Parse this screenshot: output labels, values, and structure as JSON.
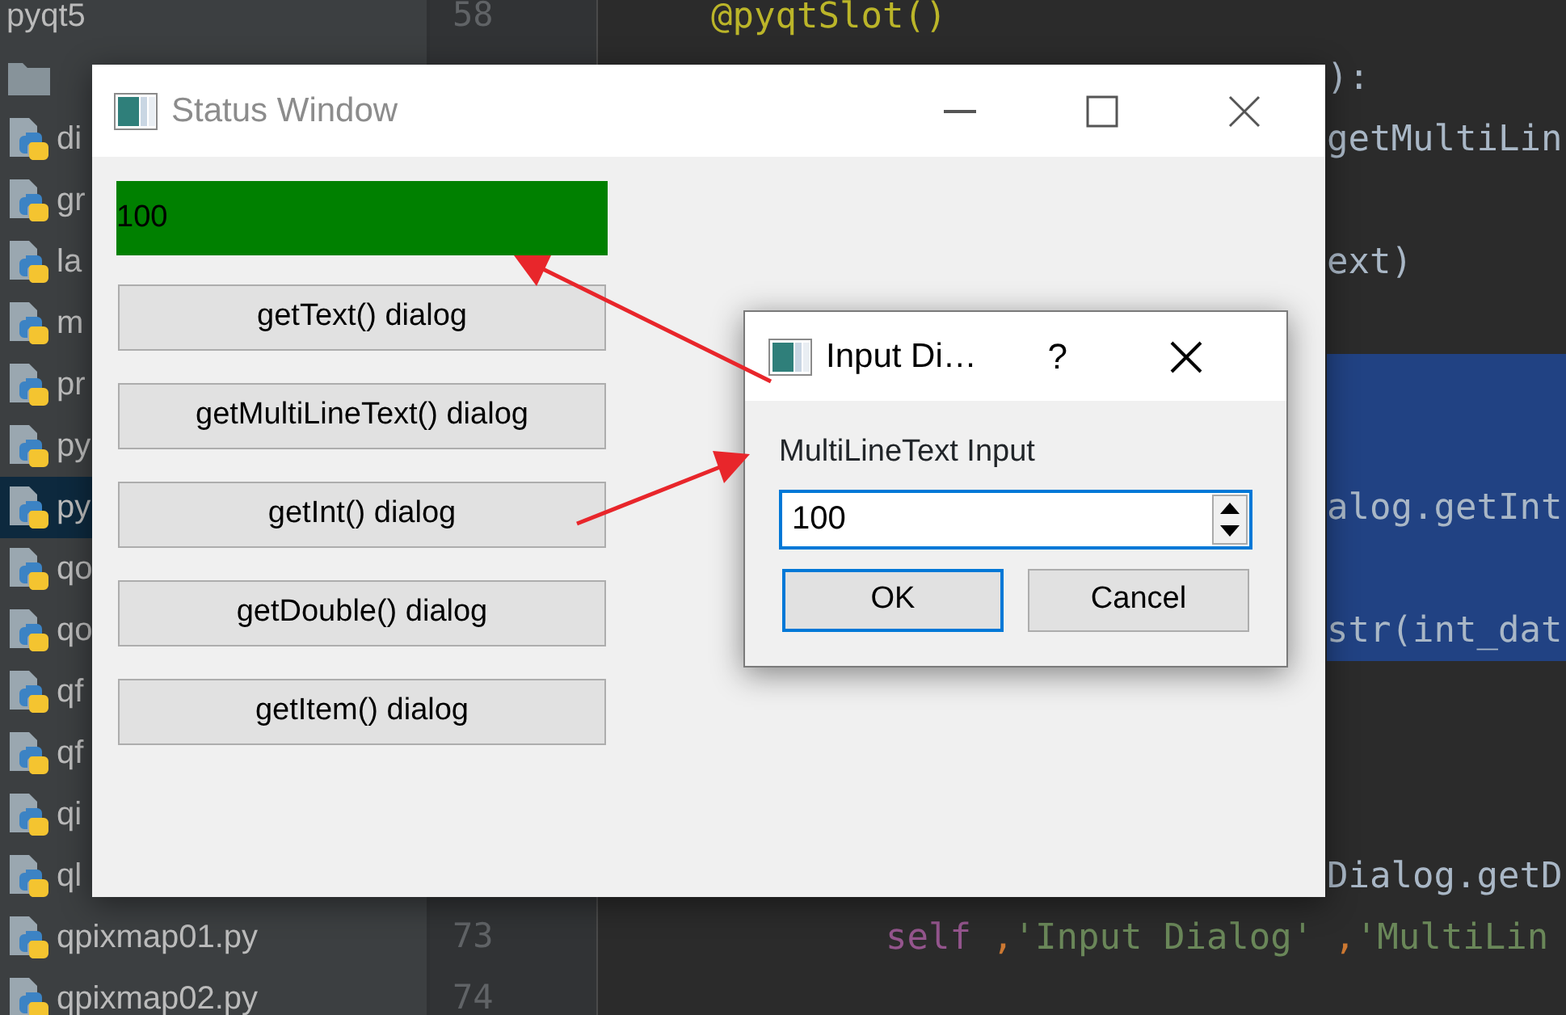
{
  "tree": [
    {
      "label": "pyqt5",
      "kind": "root",
      "selected": false
    },
    {
      "kind": "folder",
      "selected": false
    },
    {
      "label": "di",
      "kind": "python",
      "selected": false
    },
    {
      "label": "gr",
      "kind": "python",
      "selected": false
    },
    {
      "label": "la",
      "kind": "python",
      "selected": false
    },
    {
      "label": "m",
      "kind": "python",
      "selected": false
    },
    {
      "label": "pr",
      "kind": "python",
      "selected": false
    },
    {
      "label": "py",
      "kind": "python",
      "selected": false
    },
    {
      "label": "py",
      "kind": "python",
      "selected": true
    },
    {
      "label": "qo",
      "kind": "python",
      "selected": false
    },
    {
      "label": "qo",
      "kind": "python",
      "selected": false
    },
    {
      "label": "qf",
      "kind": "python",
      "selected": false
    },
    {
      "label": "qf",
      "kind": "python",
      "selected": false
    },
    {
      "label": "qi",
      "kind": "python",
      "selected": false
    },
    {
      "label": "ql",
      "kind": "python",
      "selected": false
    },
    {
      "label": "qpixmap01.py",
      "kind": "python",
      "selected": false
    },
    {
      "label": "qpixmap02.py",
      "kind": "python",
      "selected": false
    }
  ],
  "code_lines": [
    {
      "number": "58",
      "kind": "code",
      "segments": [
        {
          "text": "@pyqtSlot()",
          "kind": "decorator"
        }
      ]
    },
    {
      "kind": "clipped",
      "segments": [
        {
          "text": "):",
          "kind": "plain"
        }
      ]
    },
    {
      "kind": "clipped",
      "segments": [
        {
          "text": "getMultiLin",
          "kind": "plain"
        }
      ]
    },
    {
      "kind": "blank"
    },
    {
      "kind": "clipped",
      "segments": [
        {
          "text": "ext)",
          "kind": "plain"
        }
      ]
    },
    {
      "kind": "blank"
    },
    {
      "kind": "highlight"
    },
    {
      "kind": "highlight"
    },
    {
      "kind": "highlight",
      "segments": [
        {
          "text": "alog.getInt",
          "kind": "plain"
        }
      ]
    },
    {
      "kind": "highlight"
    },
    {
      "kind": "highlight",
      "segments": [
        {
          "text": "str(int_dat",
          "kind": "plain"
        }
      ]
    },
    {
      "kind": "blank"
    },
    {
      "kind": "blank"
    },
    {
      "kind": "blank"
    },
    {
      "kind": "clipped",
      "segments": [
        {
          "text": "Dialog.getD",
          "kind": "plain"
        }
      ]
    },
    {
      "number": "73",
      "kind": "continuation",
      "segments": [
        {
          "text": "self",
          "kind": "self"
        },
        {
          "text": ",",
          "kind": "punct"
        },
        {
          "text": "'Input Dialog'",
          "kind": "string"
        },
        {
          "text": ",",
          "kind": "punct"
        },
        {
          "text": "'MultiLin",
          "kind": "string"
        }
      ]
    },
    {
      "number": "74",
      "kind": "code"
    }
  ],
  "status_window": {
    "title": "Status Window",
    "active": false,
    "status_label": "100",
    "buttons": [
      "getText() dialog",
      "getMultiLineText() dialog",
      "getInt() dialog",
      "getDouble() dialog",
      "getItem() dialog"
    ]
  },
  "input_dialog": {
    "title": "Input Di…",
    "active": true,
    "help": "?",
    "prompt": "MultiLineText Input",
    "value": "100",
    "buttons": [
      {
        "label": "OK",
        "default": true
      },
      {
        "label": "Cancel",
        "default": false
      }
    ]
  }
}
